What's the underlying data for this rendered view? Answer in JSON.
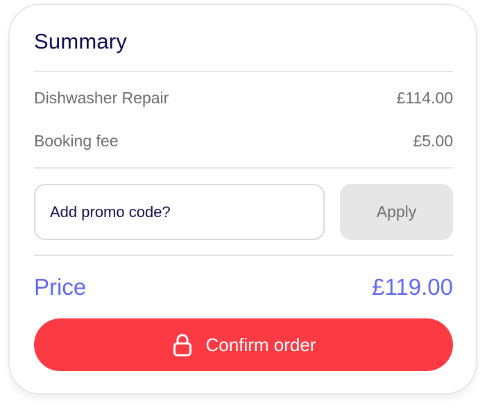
{
  "summary": {
    "title": "Summary",
    "items": [
      {
        "label": "Dishwasher Repair",
        "amount": "£114.00"
      },
      {
        "label": "Booking fee",
        "amount": "£5.00"
      }
    ],
    "promo": {
      "placeholder": "Add promo code?",
      "apply_label": "Apply"
    },
    "total": {
      "label": "Price",
      "amount": "£119.00"
    },
    "confirm": {
      "label": "Confirm order",
      "icon": "lock-icon"
    }
  },
  "colors": {
    "title": "#0b0a4d",
    "accent": "#5f67ee",
    "confirm_bg": "#fb3a43",
    "apply_bg": "#e6e6e6"
  }
}
